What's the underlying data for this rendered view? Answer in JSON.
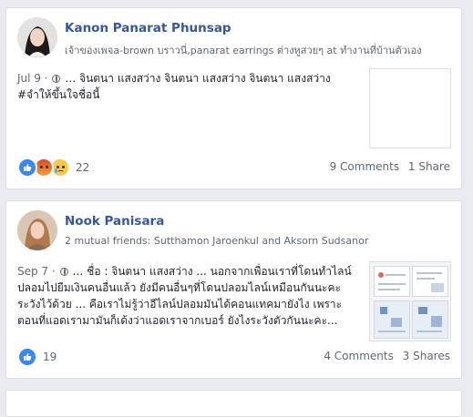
{
  "posts": [
    {
      "name": "Kanon Panarat Phunsap",
      "subline": "เจ้าของเพจa-brown บราวนี่,panarat earrings ต่างหูสวยๆ at ทำงานที่บ้านตัวเอง",
      "date": "Jul 9 ·",
      "text": " … จินตนา แสงสว่าง จินตนา แสงสว่าง จินตนา แสงสว่าง",
      "text2": "#จำให้ขึ้นใจชื่อนี้",
      "reaction_count": "22",
      "comments": "9 Comments",
      "shares": "1 Share"
    },
    {
      "name": "Nook Panisara",
      "subline": "2 mutual friends: Sutthamon Jaroenkul and Aksorn Sudsanor",
      "date": "Sep 7 ·",
      "text": " … ชื่อ : จินตนา แสงสว่าง ... นอกจากเพื่อนเราที่โดนทำไลน์ปลอมไปยืมเงินคนอื่นแล้ว ยังมีคนอื่นๆที่โดนปลอมไลน์เหมือนกันนะคะ ระวังไว้ด้วย ... คือเราไม่รู้ว่าอีไลน์ปลอมมันได้คอนแทคมายังไง เพราะตอนที่แอดเรามามันก็เด้งว่าแอดเราจากเบอร์ ยังไงระวังตัวกันนะคะ...",
      "reaction_count": "19",
      "comments": "4 Comments",
      "shares": "3 Shares"
    }
  ]
}
